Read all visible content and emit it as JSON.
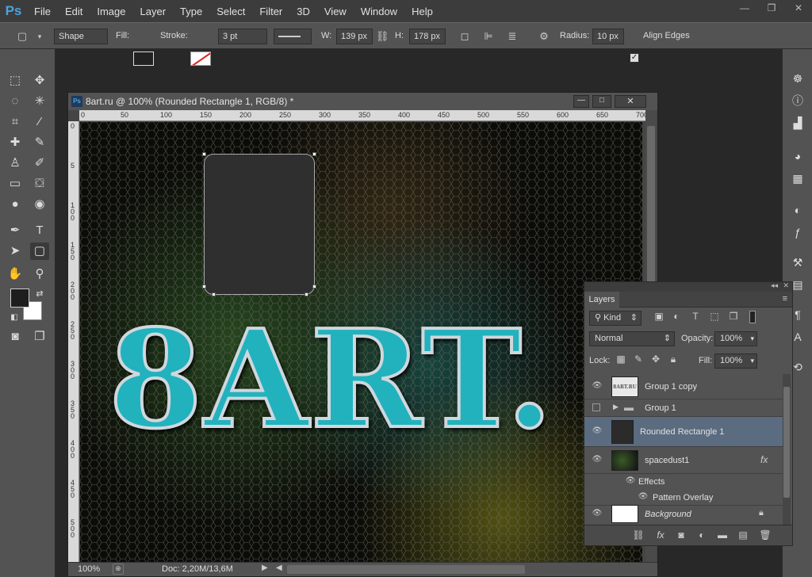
{
  "app": {
    "logo": "Ps"
  },
  "menu": [
    "File",
    "Edit",
    "Image",
    "Layer",
    "Type",
    "Select",
    "Filter",
    "3D",
    "View",
    "Window",
    "Help"
  ],
  "window_controls": {
    "minimize": "—",
    "restore": "❐",
    "close": "✕"
  },
  "options": {
    "shape_mode": "Shape",
    "fill_label": "Fill:",
    "stroke_label": "Stroke:",
    "stroke_width": "3 pt",
    "w_label": "W:",
    "w_value": "139 px",
    "h_label": "H:",
    "h_value": "178 px",
    "radius_label": "Radius:",
    "radius_value": "10 px",
    "align_edges_label": "Align Edges",
    "align_edges_checked": true
  },
  "document": {
    "title": "8art.ru @ 100% (Rounded Rectangle 1, RGB/8) *",
    "ruler_top": [
      "0",
      "50",
      "100",
      "150",
      "200",
      "250",
      "300",
      "350",
      "400",
      "450",
      "500",
      "550",
      "600",
      "650",
      "700"
    ],
    "ruler_left": [
      "0",
      "5",
      "1 0 0",
      "1 5 0",
      "2 0 0",
      "2 5 0",
      "3 0 0",
      "3 5 0",
      "4 0 0",
      "4 5 0",
      "5 0 0"
    ],
    "canvas_text": "8ART.",
    "zoom": "100%",
    "doc_info": "Doc: 2,20M/13,6M"
  },
  "layers_panel": {
    "tab": "Layers",
    "filter_kind": "Kind",
    "blend_mode": "Normal",
    "opacity_label": "Opacity:",
    "opacity_value": "100%",
    "lock_label": "Lock:",
    "fill_label": "Fill:",
    "fill_value": "100%",
    "layers": [
      {
        "name": "Group 1 copy",
        "visible": true
      },
      {
        "name": "Group 1",
        "visible": false
      },
      {
        "name": "Rounded Rectangle 1",
        "visible": true,
        "selected": true
      },
      {
        "name": "spacedust1",
        "visible": true,
        "fx": "fx"
      },
      {
        "name": "Effects",
        "visible": true
      },
      {
        "name": "Pattern Overlay",
        "visible": true
      },
      {
        "name": "Background",
        "visible": true
      }
    ],
    "thumb_group1copy": "8ART.RU"
  },
  "colors": {
    "accent": "#4aa3df",
    "selected_layer": "#5b6b80",
    "text_teal": "#27c3cf",
    "rect_fill": "#2f2f2f"
  }
}
